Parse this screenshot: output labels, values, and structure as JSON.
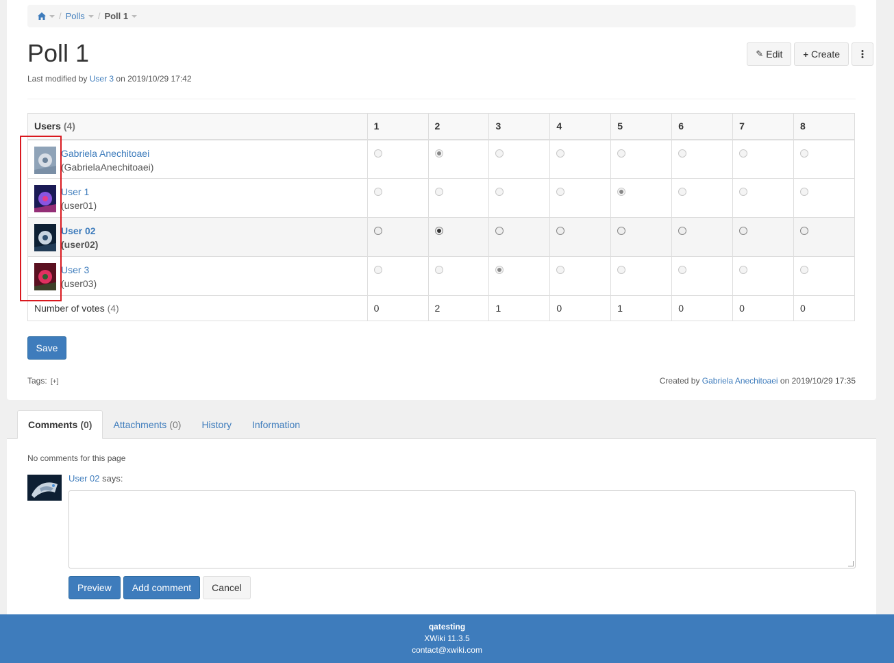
{
  "breadcrumb": {
    "home_icon": "home-icon",
    "items": [
      "Polls",
      "Poll 1"
    ]
  },
  "page": {
    "title": "Poll 1",
    "modified_prefix": "Last modified by",
    "modified_user": "User 3",
    "modified_suffix": "on 2019/10/29 17:42"
  },
  "actions": {
    "edit": "Edit",
    "create": "Create",
    "more_icon": "more-vertical-icon"
  },
  "poll": {
    "users_header": "Users",
    "users_count": "(4)",
    "options": [
      "1",
      "2",
      "3",
      "4",
      "5",
      "6",
      "7",
      "8"
    ],
    "rows": [
      {
        "name": "Gabriela Anechitoaei",
        "id": "(GabrielaAnechitoaei)",
        "vote": 2,
        "highlight": false,
        "avatar_colors": [
          "#8fa3b8",
          "#d8dee6",
          "#6c8299"
        ]
      },
      {
        "name": "User 1",
        "id": "(user01)",
        "vote": 5,
        "highlight": false,
        "avatar_colors": [
          "#1a1a55",
          "#8a55e0",
          "#e43c8c"
        ]
      },
      {
        "name": "User 02",
        "id": "(user02)",
        "vote": 2,
        "highlight": true,
        "avatar_colors": [
          "#0d1f33",
          "#c8d4e0",
          "#305070"
        ]
      },
      {
        "name": "User 3",
        "id": "(user03)",
        "vote": 3,
        "highlight": false,
        "avatar_colors": [
          "#5a1020",
          "#e03060",
          "#2a6030"
        ]
      }
    ],
    "votes_label": "Number of votes",
    "votes_count": "(4)",
    "votes": [
      "0",
      "2",
      "1",
      "0",
      "1",
      "0",
      "0",
      "0"
    ]
  },
  "save": "Save",
  "tags": {
    "label": "Tags:",
    "add": "[+]"
  },
  "created": {
    "prefix": "Created by",
    "user": "Gabriela Anechitoaei",
    "suffix": "on 2019/10/29 17:35"
  },
  "tabs": [
    {
      "label": "Comments",
      "count": "(0)",
      "active": true
    },
    {
      "label": "Attachments",
      "count": "(0)",
      "active": false
    },
    {
      "label": "History",
      "count": "",
      "active": false
    },
    {
      "label": "Information",
      "count": "",
      "active": false
    }
  ],
  "comments": {
    "empty": "No comments for this page",
    "user": "User 02",
    "says": "says:",
    "preview": "Preview",
    "add": "Add comment",
    "cancel": "Cancel"
  },
  "footer": {
    "brand": "qatesting",
    "version": "XWiki 11.3.5",
    "contact": "contact@xwiki.com"
  }
}
